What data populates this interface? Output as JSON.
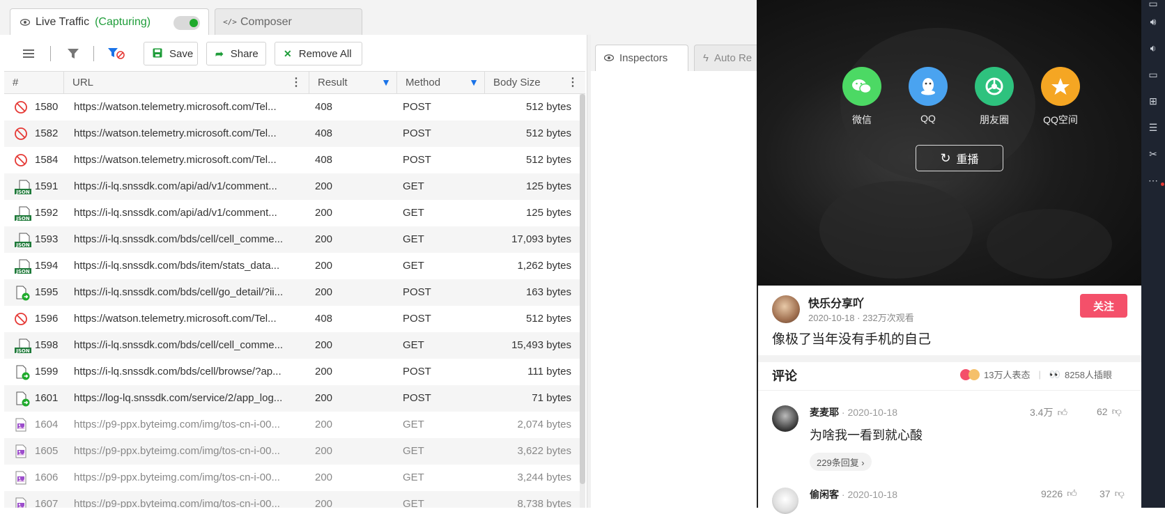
{
  "traffic": {
    "tabs": {
      "live_label": "Live Traffic",
      "capturing": "(Capturing)",
      "composer_label": "Composer"
    },
    "toolbar": {
      "save": "Save",
      "share": "Share",
      "remove_all": "Remove All"
    },
    "columns": {
      "num": "#",
      "url": "URL",
      "result": "Result",
      "method": "Method",
      "size": "Body Size"
    },
    "rows": [
      {
        "num": "1580",
        "url": "https://watson.telemetry.microsoft.com/Tel...",
        "result": "408",
        "method": "POST",
        "size": "512 bytes",
        "icon": "blocked-icon"
      },
      {
        "num": "1582",
        "url": "https://watson.telemetry.microsoft.com/Tel...",
        "result": "408",
        "method": "POST",
        "size": "512 bytes",
        "icon": "blocked-icon"
      },
      {
        "num": "1584",
        "url": "https://watson.telemetry.microsoft.com/Tel...",
        "result": "408",
        "method": "POST",
        "size": "512 bytes",
        "icon": "blocked-icon"
      },
      {
        "num": "1591",
        "url": "https://i-lq.snssdk.com/api/ad/v1/comment...",
        "result": "200",
        "method": "GET",
        "size": "125 bytes",
        "icon": "json-icon"
      },
      {
        "num": "1592",
        "url": "https://i-lq.snssdk.com/api/ad/v1/comment...",
        "result": "200",
        "method": "GET",
        "size": "125 bytes",
        "icon": "json-icon"
      },
      {
        "num": "1593",
        "url": "https://i-lq.snssdk.com/bds/cell/cell_comme...",
        "result": "200",
        "method": "GET",
        "size": "17,093 bytes",
        "icon": "json-icon"
      },
      {
        "num": "1594",
        "url": "https://i-lq.snssdk.com/bds/item/stats_data...",
        "result": "200",
        "method": "GET",
        "size": "1,262 bytes",
        "icon": "json-icon"
      },
      {
        "num": "1595",
        "url": "https://i-lq.snssdk.com/bds/cell/go_detail/?ii...",
        "result": "200",
        "method": "POST",
        "size": "163 bytes",
        "icon": "post-doc-icon"
      },
      {
        "num": "1596",
        "url": "https://watson.telemetry.microsoft.com/Tel...",
        "result": "408",
        "method": "POST",
        "size": "512 bytes",
        "icon": "blocked-icon"
      },
      {
        "num": "1598",
        "url": "https://i-lq.snssdk.com/bds/cell/cell_comme...",
        "result": "200",
        "method": "GET",
        "size": "15,493 bytes",
        "icon": "json-icon"
      },
      {
        "num": "1599",
        "url": "https://i-lq.snssdk.com/bds/cell/browse/?ap...",
        "result": "200",
        "method": "POST",
        "size": "111 bytes",
        "icon": "post-doc-icon"
      },
      {
        "num": "1601",
        "url": "https://log-lq.snssdk.com/service/2/app_log...",
        "result": "200",
        "method": "POST",
        "size": "71 bytes",
        "icon": "post-doc-icon"
      },
      {
        "num": "1604",
        "url": "https://p9-ppx.byteimg.com/img/tos-cn-i-00...",
        "result": "200",
        "method": "GET",
        "size": "2,074 bytes",
        "icon": "image-icon"
      },
      {
        "num": "1605",
        "url": "https://p9-ppx.byteimg.com/img/tos-cn-i-00...",
        "result": "200",
        "method": "GET",
        "size": "3,622 bytes",
        "icon": "image-icon"
      },
      {
        "num": "1606",
        "url": "https://p9-ppx.byteimg.com/img/tos-cn-i-00...",
        "result": "200",
        "method": "GET",
        "size": "3,244 bytes",
        "icon": "image-icon"
      },
      {
        "num": "1607",
        "url": "https://p9-ppx.byteimg.com/img/tos-cn-i-00...",
        "result": "200",
        "method": "GET",
        "size": "8,738 bytes",
        "icon": "image-icon"
      }
    ],
    "right_tabs": {
      "inspectors": "Inspectors",
      "auto": "Auto Re"
    }
  },
  "app": {
    "share_targets": [
      "微信",
      "QQ",
      "朋友圈",
      "QQ空间"
    ],
    "share_colors": [
      "#4cd964",
      "#4aa3f0",
      "#2ec27e",
      "#f5a623"
    ],
    "replay": "重播",
    "author": {
      "name": "快乐分享吖",
      "meta": "2020-10-18 · 232万次观看",
      "follow": "关注"
    },
    "video_title": "像极了当年没有手机的自己",
    "comments_header": "评论",
    "reactions": "13万人表态",
    "inserts": "8258人插眼",
    "comments": [
      {
        "name": "麦麦耶",
        "date": "· 2020-10-18",
        "text": "为啥我一看到就心酸",
        "likes": "3.4万",
        "dislikes": "62",
        "replies": "229条回复 ›"
      },
      {
        "name": "偷闲客",
        "date": "· 2020-10-18",
        "likes": "9226",
        "dislikes": "37"
      }
    ]
  },
  "colors": {
    "accent_green": "#1f9d3a",
    "follow_red": "#f4506a",
    "filter_blue": "#1a73e8"
  }
}
